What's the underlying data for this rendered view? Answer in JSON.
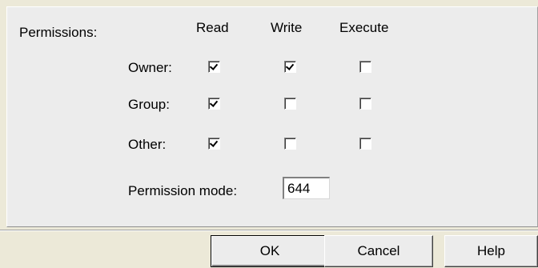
{
  "permissions": {
    "section_label": "Permissions:",
    "columns": {
      "read": "Read",
      "write": "Write",
      "execute": "Execute"
    },
    "rows": [
      {
        "label": "Owner:",
        "read": true,
        "write": true,
        "execute": false
      },
      {
        "label": "Group:",
        "read": true,
        "write": false,
        "execute": false
      },
      {
        "label": "Other:",
        "read": true,
        "write": false,
        "execute": false
      }
    ],
    "mode": {
      "label": "Permission mode:",
      "value": "644"
    }
  },
  "buttons": {
    "ok": "OK",
    "cancel": "Cancel",
    "help": "Help"
  },
  "colors": {
    "background": "#ececec",
    "text": "#000000",
    "input_background": "#ffffff"
  },
  "icons": {
    "checked": "checkbox-checked-icon",
    "unchecked": "checkbox-unchecked-icon"
  }
}
